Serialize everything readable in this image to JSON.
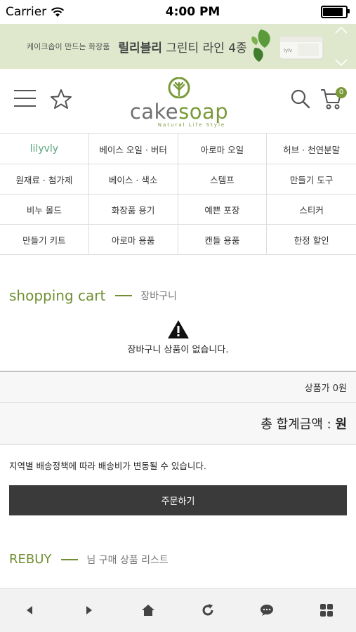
{
  "status_bar": {
    "carrier": "Carrier",
    "time": "4:00 PM",
    "battery_level": 1.0
  },
  "banner": {
    "tagline": "케이크솝이 만드는 화장품",
    "brand": "릴리블리",
    "product_line": "그린티 라인 4종",
    "product_label": "lylv"
  },
  "header": {
    "logo_text_1": "cake",
    "logo_text_2": "soap",
    "logo_tagline": "Natural Life Style",
    "cart_count": "0"
  },
  "categories": [
    "lilyvly",
    "베이스 오일 · 버터",
    "아로마 오일",
    "허브 · 천연분말",
    "원재료 · 첨가제",
    "베이스 · 색소",
    "스템프",
    "만들기 도구",
    "비누 몰드",
    "화장품 용기",
    "예쁜 포장",
    "스티커",
    "만들기 키트",
    "아로마 용품",
    "캔들 용품",
    "한정 할인"
  ],
  "cart": {
    "title_en": "shopping cart",
    "title_ko": "장바구니",
    "empty_message": "장바구니 상품이 없습니다.",
    "subtotal": "상품가 0원",
    "total_label": "총 합계금액 :",
    "total_value": "원",
    "shipping_notice": "지역별 배송정책에 따라 배송비가 변동될 수 있습니다.",
    "order_button": "주문하기"
  },
  "rebuy": {
    "title_en": "REBUY",
    "title_ko": "님 구매 상품 리스트"
  },
  "toolbar": {
    "items": [
      "back-icon",
      "forward-icon",
      "home-icon",
      "refresh-icon",
      "chat-icon",
      "grid-menu-icon"
    ]
  },
  "colors": {
    "brand_green": "#7a9a3a",
    "banner_bg": "#dfe8cd",
    "button_dark": "#3a3a3a"
  }
}
